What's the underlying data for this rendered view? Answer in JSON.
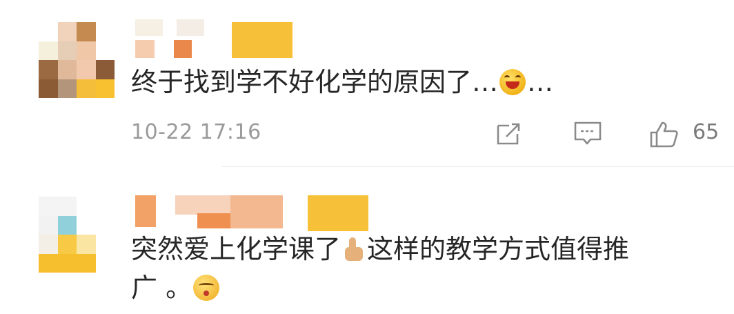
{
  "comments": [
    {
      "text": "终于找到学不好化学的原因了…",
      "text_after_emoji": "…",
      "emoji_1": "laughing-emoji",
      "time": "10-22 17:16",
      "like_count": "65",
      "actions": {
        "share_icon": "share-icon",
        "comment_icon": "comment-icon",
        "like_icon": "thumbs-up-icon"
      }
    },
    {
      "text_part1": "突然爱上化学课了",
      "emoji_1": "thumbs-up-emoji",
      "text_part2": "这样的教学方式值得推",
      "text_part3": "广 。",
      "emoji_2": "blushing-kiss-emoji"
    }
  ],
  "colors": {
    "text": "#262626",
    "meta": "#9a9a9a",
    "icon": "#8a8a8a",
    "divider": "#ececec"
  }
}
